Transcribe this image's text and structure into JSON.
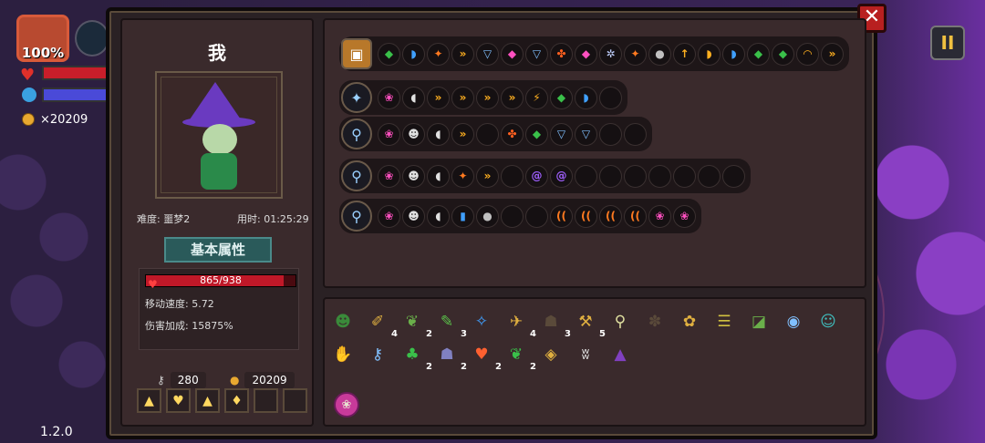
{
  "hud": {
    "hp_percent": "100%",
    "coins": "×20209",
    "version": "1.2.0"
  },
  "close_label": "✕",
  "pause_label": "II",
  "character": {
    "name": "我",
    "difficulty": "难度: 噩梦2",
    "time": "用时: 01:25:29",
    "basic_attr_label": "基本属性",
    "hp_text": "865/938",
    "hp_fraction": 0.922,
    "move_speed": "移动速度: 5.72",
    "damage_bonus": "伤害加成: 15875%",
    "keys": "280",
    "gold": "20209",
    "potion_slots": [
      "▲",
      "♥",
      "▲",
      "♦",
      "",
      ""
    ]
  },
  "skill_bar": {
    "chips": [
      {
        "g": "◆",
        "c": "#3ac04a"
      },
      {
        "g": "◗",
        "c": "#40a0ff"
      },
      {
        "g": "✦",
        "c": "#ff7a20"
      },
      {
        "g": "»",
        "c": "#ffb020"
      },
      {
        "g": "▽",
        "c": "#80c0ff"
      },
      {
        "g": "◆",
        "c": "#ff50c0"
      },
      {
        "g": "▽",
        "c": "#80c0ff"
      },
      {
        "g": "✤",
        "c": "#ff6020"
      },
      {
        "g": "◆",
        "c": "#ff50c0"
      },
      {
        "g": "✲",
        "c": "#c0d0ff"
      },
      {
        "g": "✦",
        "c": "#ff7a20"
      },
      {
        "g": "●",
        "c": "#c0c0c0"
      },
      {
        "g": "↑",
        "c": "#ffb020"
      },
      {
        "g": "◗",
        "c": "#ffb020"
      },
      {
        "g": "◗",
        "c": "#40a0ff"
      },
      {
        "g": "◆",
        "c": "#3ac04a"
      },
      {
        "g": "◆",
        "c": "#3ac04a"
      },
      {
        "g": "◠",
        "c": "#ffb020"
      },
      {
        "g": "»",
        "c": "#ffb020"
      }
    ]
  },
  "weapons": [
    {
      "icon": "✦",
      "chips": [
        {
          "g": "❀",
          "c": "#ff50c0"
        },
        {
          "g": "◖",
          "c": "#e0e0e0"
        },
        {
          "g": "»",
          "c": "#ffb020"
        },
        {
          "g": "»",
          "c": "#ffb020"
        },
        {
          "g": "»",
          "c": "#ffb020"
        },
        {
          "g": "»",
          "c": "#ffb020"
        },
        {
          "g": "⚡",
          "c": "#ffb020"
        },
        {
          "g": "◆",
          "c": "#3ac04a"
        },
        {
          "g": "◗",
          "c": "#40a0ff"
        },
        {
          "g": "",
          "c": "#fff"
        }
      ]
    },
    {
      "icon": "⚲",
      "chips": [
        {
          "g": "❀",
          "c": "#ff50c0"
        },
        {
          "g": "☻",
          "c": "#e0e0e0"
        },
        {
          "g": "◖",
          "c": "#e0e0e0"
        },
        {
          "g": "»",
          "c": "#ffb020"
        },
        {
          "g": "",
          "c": "#fff"
        },
        {
          "g": "✤",
          "c": "#ff6020"
        },
        {
          "g": "◆",
          "c": "#3ac04a"
        },
        {
          "g": "▽",
          "c": "#80c0ff"
        },
        {
          "g": "▽",
          "c": "#80c0ff"
        },
        {
          "g": "",
          "c": "#fff"
        },
        {
          "g": "",
          "c": "#fff"
        }
      ]
    },
    {
      "icon": "⚲",
      "chips": [
        {
          "g": "❀",
          "c": "#ff50c0"
        },
        {
          "g": "☻",
          "c": "#e0e0e0"
        },
        {
          "g": "◖",
          "c": "#e0e0e0"
        },
        {
          "g": "✦",
          "c": "#ff7a20"
        },
        {
          "g": "»",
          "c": "#ffb020"
        },
        {
          "g": "",
          "c": "#fff"
        },
        {
          "g": "@",
          "c": "#a060ff"
        },
        {
          "g": "@",
          "c": "#a060ff"
        },
        {
          "g": "",
          "c": "#fff"
        },
        {
          "g": "",
          "c": "#fff"
        },
        {
          "g": "",
          "c": "#fff"
        },
        {
          "g": "",
          "c": "#fff"
        },
        {
          "g": "",
          "c": "#fff"
        },
        {
          "g": "",
          "c": "#fff"
        },
        {
          "g": "",
          "c": "#fff"
        }
      ]
    },
    {
      "icon": "⚲",
      "chips": [
        {
          "g": "❀",
          "c": "#ff50c0"
        },
        {
          "g": "☻",
          "c": "#e0e0e0"
        },
        {
          "g": "◖",
          "c": "#e0e0e0"
        },
        {
          "g": "▮",
          "c": "#40a0ff"
        },
        {
          "g": "●",
          "c": "#c0c0c0"
        },
        {
          "g": "",
          "c": "#fff"
        },
        {
          "g": "",
          "c": "#fff"
        },
        {
          "g": "((",
          "c": "#ff7a20"
        },
        {
          "g": "((",
          "c": "#ff7a20"
        },
        {
          "g": "((",
          "c": "#ff7a20"
        },
        {
          "g": "((",
          "c": "#ff7a20"
        },
        {
          "g": "❀",
          "c": "#ff50c0"
        },
        {
          "g": "❀",
          "c": "#ff50c0"
        }
      ]
    }
  ],
  "items": [
    {
      "g": "☻",
      "c": "#3a8a3a",
      "n": ""
    },
    {
      "g": "✐",
      "c": "#e0b040",
      "n": "4"
    },
    {
      "g": "❦",
      "c": "#6ab04a",
      "n": "2"
    },
    {
      "g": "✎",
      "c": "#5ac04a",
      "n": "3"
    },
    {
      "g": "✧",
      "c": "#40a0ff",
      "n": ""
    },
    {
      "g": "✈",
      "c": "#e0b040",
      "n": "4"
    },
    {
      "g": "☗",
      "c": "#5a4a3a",
      "n": "3"
    },
    {
      "g": "⚒",
      "c": "#e0b040",
      "n": "5"
    },
    {
      "g": "⚲",
      "c": "#e0e0a0",
      "n": ""
    },
    {
      "g": "✽",
      "c": "#5a4a3a",
      "n": ""
    },
    {
      "g": "✿",
      "c": "#e0b040",
      "n": ""
    },
    {
      "g": "☰",
      "c": "#d0c040",
      "n": ""
    },
    {
      "g": "◪",
      "c": "#6ab04a",
      "n": ""
    },
    {
      "g": "◉",
      "c": "#80c0ff",
      "n": ""
    },
    {
      "g": "☺",
      "c": "#40c0c0",
      "n": ""
    },
    {
      "g": "✋",
      "c": "#e0b040",
      "n": ""
    },
    {
      "g": "⚷",
      "c": "#80c0ff",
      "n": ""
    },
    {
      "g": "♣",
      "c": "#3ac04a",
      "n": "2"
    },
    {
      "g": "☗",
      "c": "#8080c0",
      "n": "2"
    },
    {
      "g": "♥",
      "c": "#ff6030",
      "n": "2"
    },
    {
      "g": "❦",
      "c": "#3ac04a",
      "n": "2"
    },
    {
      "g": "◈",
      "c": "#e0b040",
      "n": ""
    },
    {
      "g": "ʬ",
      "c": "#e0e0e0",
      "n": ""
    },
    {
      "g": "▲",
      "c": "#8040c0",
      "n": ""
    }
  ],
  "extra_item": "❀"
}
